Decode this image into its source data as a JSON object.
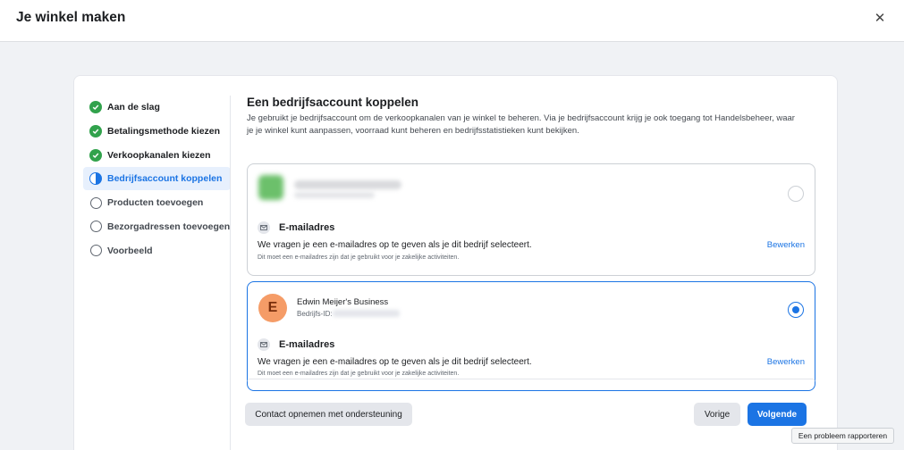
{
  "header": {
    "title": "Je winkel maken",
    "close_glyph": "✕"
  },
  "steps": [
    {
      "label": "Aan de slag",
      "state": "done"
    },
    {
      "label": "Betalingsmethode kiezen",
      "state": "done"
    },
    {
      "label": "Verkoopkanalen kiezen",
      "state": "done"
    },
    {
      "label": "Bedrijfsaccount koppelen",
      "state": "active"
    },
    {
      "label": "Producten toevoegen",
      "state": "todo"
    },
    {
      "label": "Bezorgadressen toevoegen",
      "state": "todo"
    },
    {
      "label": "Voorbeeld",
      "state": "todo"
    }
  ],
  "main": {
    "title": "Een bedrijfsaccount koppelen",
    "description": "Je gebruikt je bedrijfsaccount om de verkoopkanalen van je winkel te beheren. Via je bedrijfsaccount krijg je ook toegang tot Handelsbeheer, waar je je winkel kunt aanpassen, voorraad kunt beheren en bedrijfsstatistieken kunt bekijken."
  },
  "accounts": [
    {
      "selected": false,
      "email_title": "E-mailadres",
      "email_desc": "We vragen je een e-mailadres op te geven als je dit bedrijf selecteert.",
      "email_note": "Dit moet een e-mailadres zijn dat je gebruikt voor je zakelijke activiteiten.",
      "edit_label": "Bewerken"
    },
    {
      "selected": true,
      "avatar_letter": "E",
      "name": "Edwin Meijer's Business",
      "id_label": "Bedrijfs-ID:",
      "email_title": "E-mailadres",
      "email_desc": "We vragen je een e-mailadres op te geven als je dit bedrijf selecteert.",
      "email_note": "Dit moet een e-mailadres zijn dat je gebruikt voor je zakelijke activiteiten.",
      "edit_label": "Bewerken"
    }
  ],
  "footer": {
    "support_label": "Contact opnemen met ondersteuning",
    "prev_label": "Vorige",
    "next_label": "Volgende"
  },
  "report_label": "Een probleem rapporteren",
  "colors": {
    "accent": "#1b74e4",
    "done": "#31a24c",
    "avatar": "#f59c67"
  }
}
